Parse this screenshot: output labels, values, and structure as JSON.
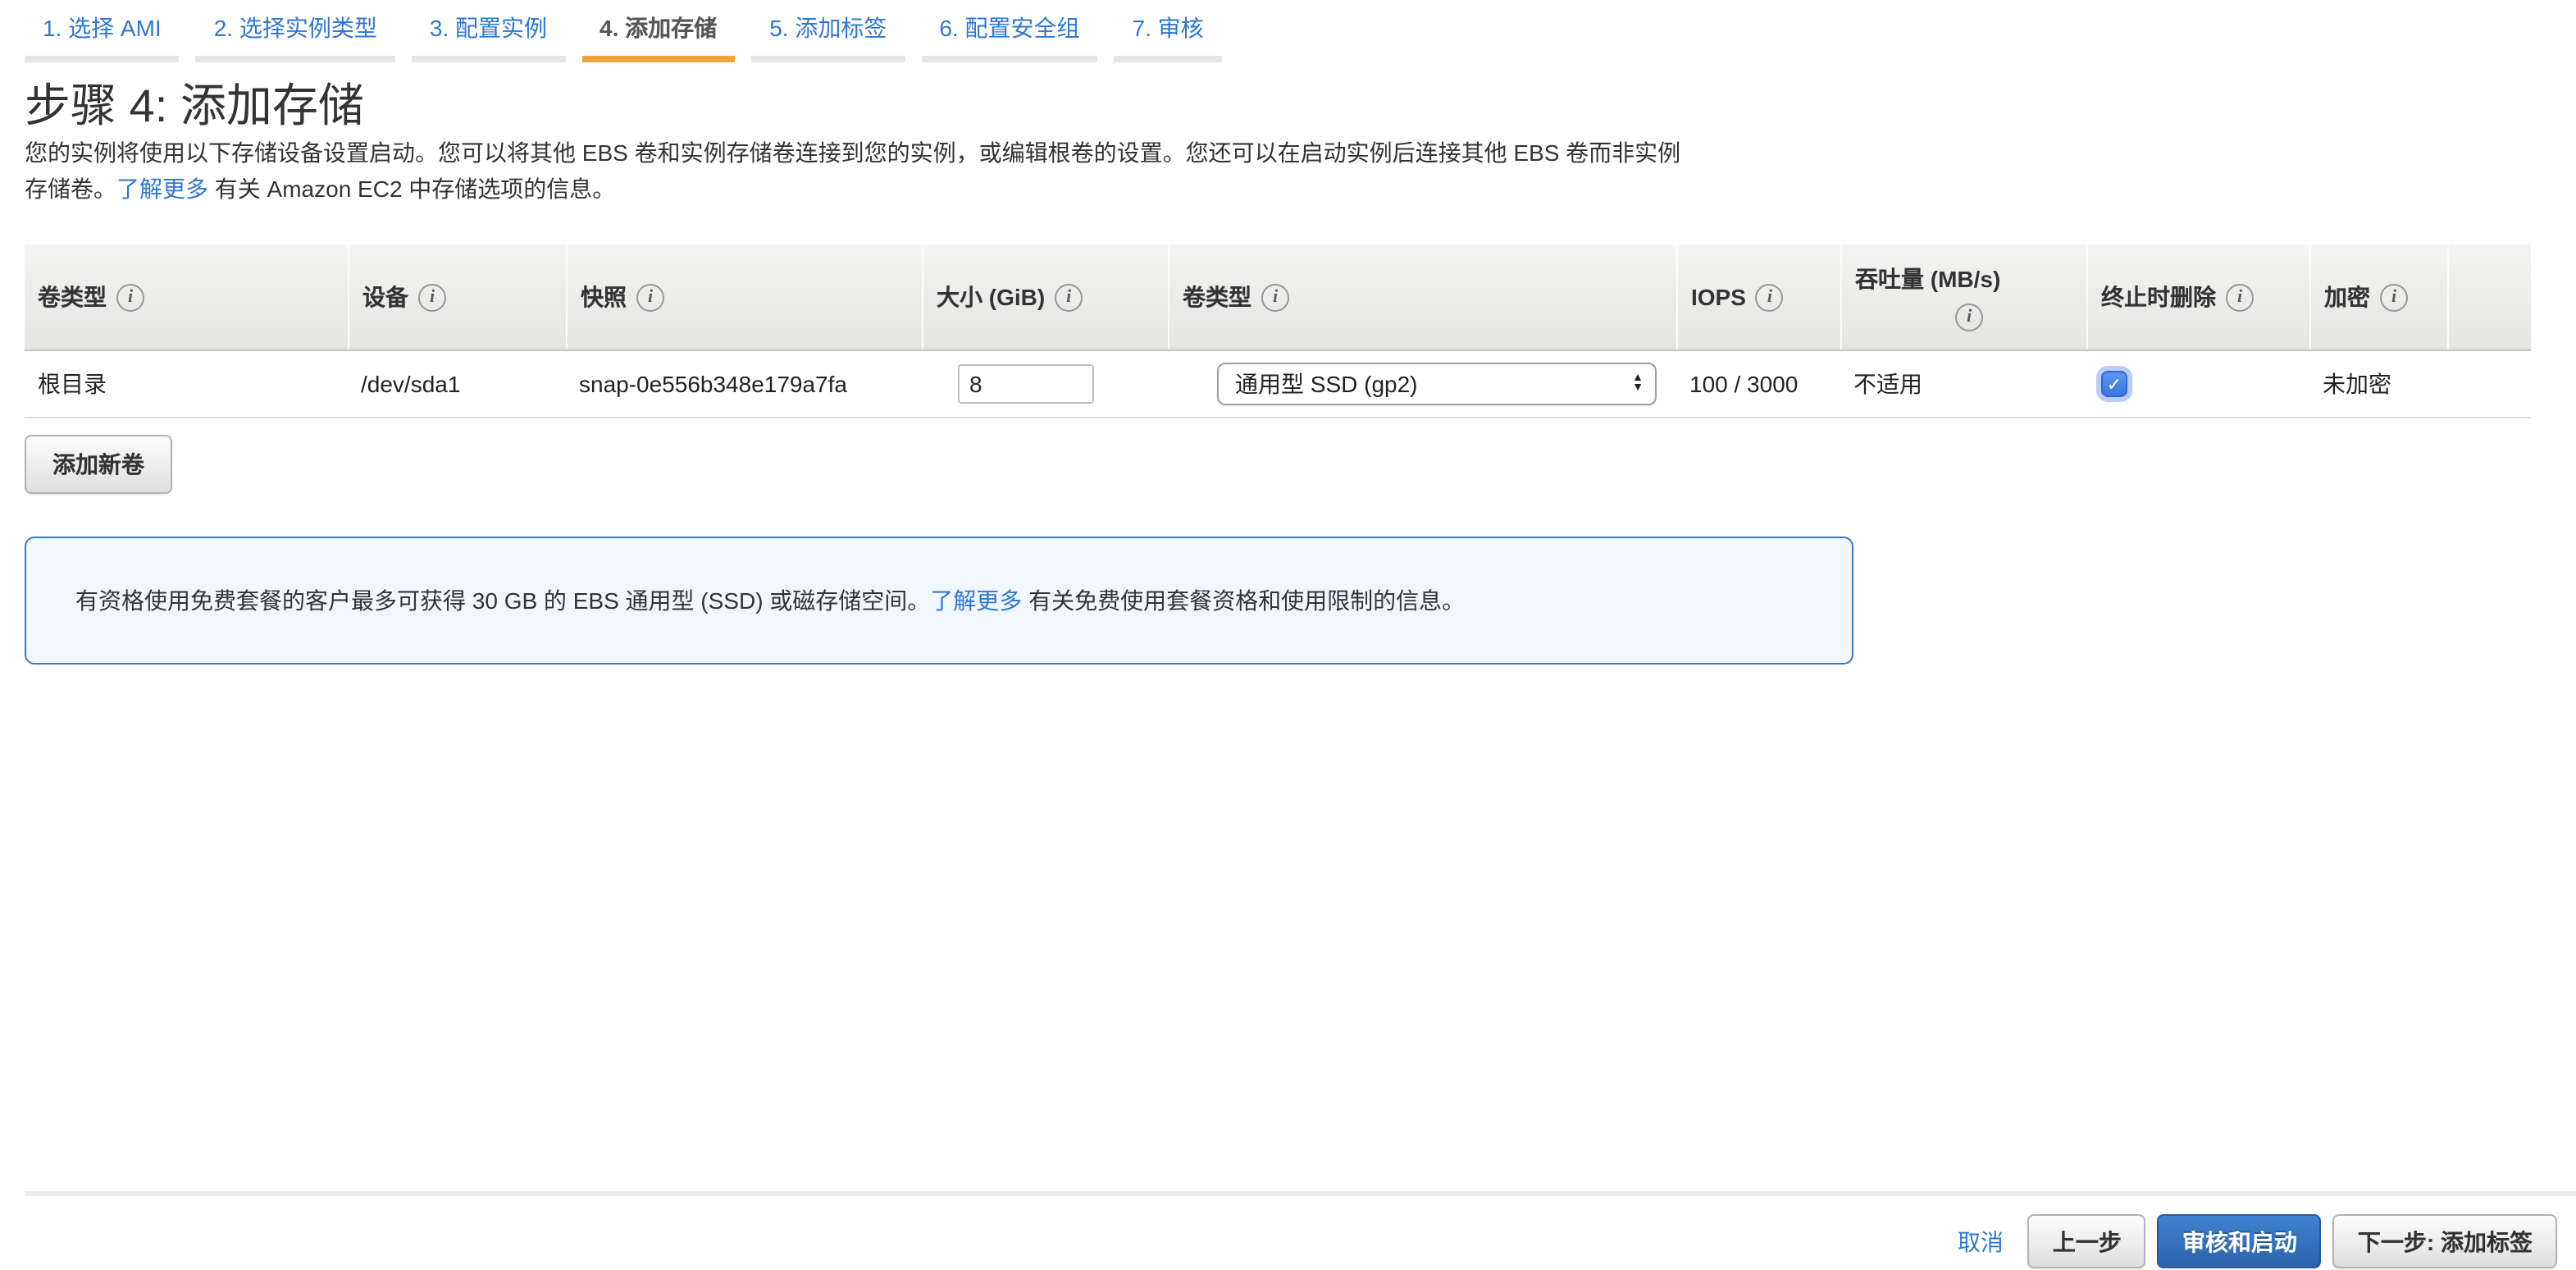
{
  "wizard_tabs": [
    {
      "label": "1. 选择 AMI",
      "active": false
    },
    {
      "label": "2. 选择实例类型",
      "active": false
    },
    {
      "label": "3. 配置实例",
      "active": false
    },
    {
      "label": "4. 添加存储",
      "active": true
    },
    {
      "label": "5. 添加标签",
      "active": false
    },
    {
      "label": "6. 配置安全组",
      "active": false
    },
    {
      "label": "7. 审核",
      "active": false
    }
  ],
  "page": {
    "title": "步骤 4: 添加存储",
    "description_line1": "您的实例将使用以下存储设备设置启动。您可以将其他 EBS 卷和实例存储卷连接到您的实例，或编辑根卷的设置。您还可以在启动实例后连接其他 EBS 卷而非实例",
    "description_line2_prefix": "存储卷。",
    "description_link": "了解更多",
    "description_line2_suffix": " 有关 Amazon EC2 中存储选项的信息。"
  },
  "storage_table": {
    "headers": [
      {
        "label": "卷类型"
      },
      {
        "label": "设备"
      },
      {
        "label": "快照"
      },
      {
        "label": "大小 (GiB)"
      },
      {
        "label": "卷类型"
      },
      {
        "label": "IOPS"
      },
      {
        "label": "吞吐量 (MB/s)"
      },
      {
        "label": "终止时删除"
      },
      {
        "label": "加密"
      }
    ],
    "row": {
      "volume": "根目录",
      "device": "/dev/sda1",
      "snapshot": "snap-0e556b348e179a7fa",
      "size_value": "8",
      "volume_type_selected": "通用型 SSD (gp2)",
      "iops": "100 / 3000",
      "throughput": "不适用",
      "delete_on_termination": true,
      "encryption": "未加密"
    }
  },
  "add_volume_button": "添加新卷",
  "free_tier_notice": {
    "text_before": "有资格使用免费套餐的客户最多可获得 30 GB 的 EBS 通用型 (SSD) 或磁存储空间。",
    "link": "了解更多",
    "text_after": " 有关免费使用套餐资格和使用限制的信息。"
  },
  "footer": {
    "cancel": "取消",
    "previous": "上一步",
    "review_launch": "审核和启动",
    "next": "下一步: 添加标签"
  },
  "icons": {
    "info": "i",
    "check": "✓",
    "arrow_up": "▲",
    "arrow_down": "▼"
  },
  "colors": {
    "accent_orange": "#efa13d",
    "link_blue": "#2e77d4",
    "primary_button_top": "#3f83d2",
    "primary_button_bottom": "#2a63a9",
    "notice_border": "#3e77c2",
    "notice_bg": "#f0f7fd",
    "checkbox_blue": "#3d7ce3",
    "header_bg_top": "#f4f4f2",
    "header_bg_bottom": "#e4e4e2"
  }
}
